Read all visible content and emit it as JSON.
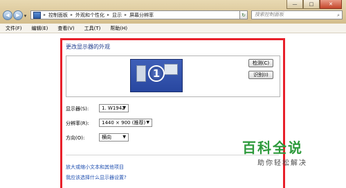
{
  "address_bar": {
    "segments": [
      "控制面板",
      "外观和个性化",
      "显示",
      "屏幕分辨率"
    ]
  },
  "search": {
    "placeholder": "搜索控制面板"
  },
  "window_controls": {
    "minimize": "—",
    "maximize": "□",
    "close": "✕"
  },
  "menu": [
    "文件(F)",
    "编辑(E)",
    "查看(V)",
    "工具(T)",
    "帮助(H)"
  ],
  "panel": {
    "heading": "更改显示器的外观",
    "monitor_number": "1",
    "detect_button": "检测(C)",
    "identify_button": "识别(I)"
  },
  "settings": {
    "display_label": "显示器(S):",
    "display_value": "1. W1942",
    "resolution_label": "分辨率(R):",
    "resolution_value": "1440 × 900 (推荐)",
    "orientation_label": "方向(O):",
    "orientation_value": "横向"
  },
  "links": {
    "text_size": "放大或缩小文本和其他项目",
    "which_settings": "我应该选择什么显示器设置?"
  },
  "watermark": {
    "title": "百科全说",
    "subtitle": "助你轻松解决"
  },
  "colors": {
    "highlight": "#e8202a",
    "link": "#1f4fb0",
    "watermark": "#2e9a3c"
  }
}
